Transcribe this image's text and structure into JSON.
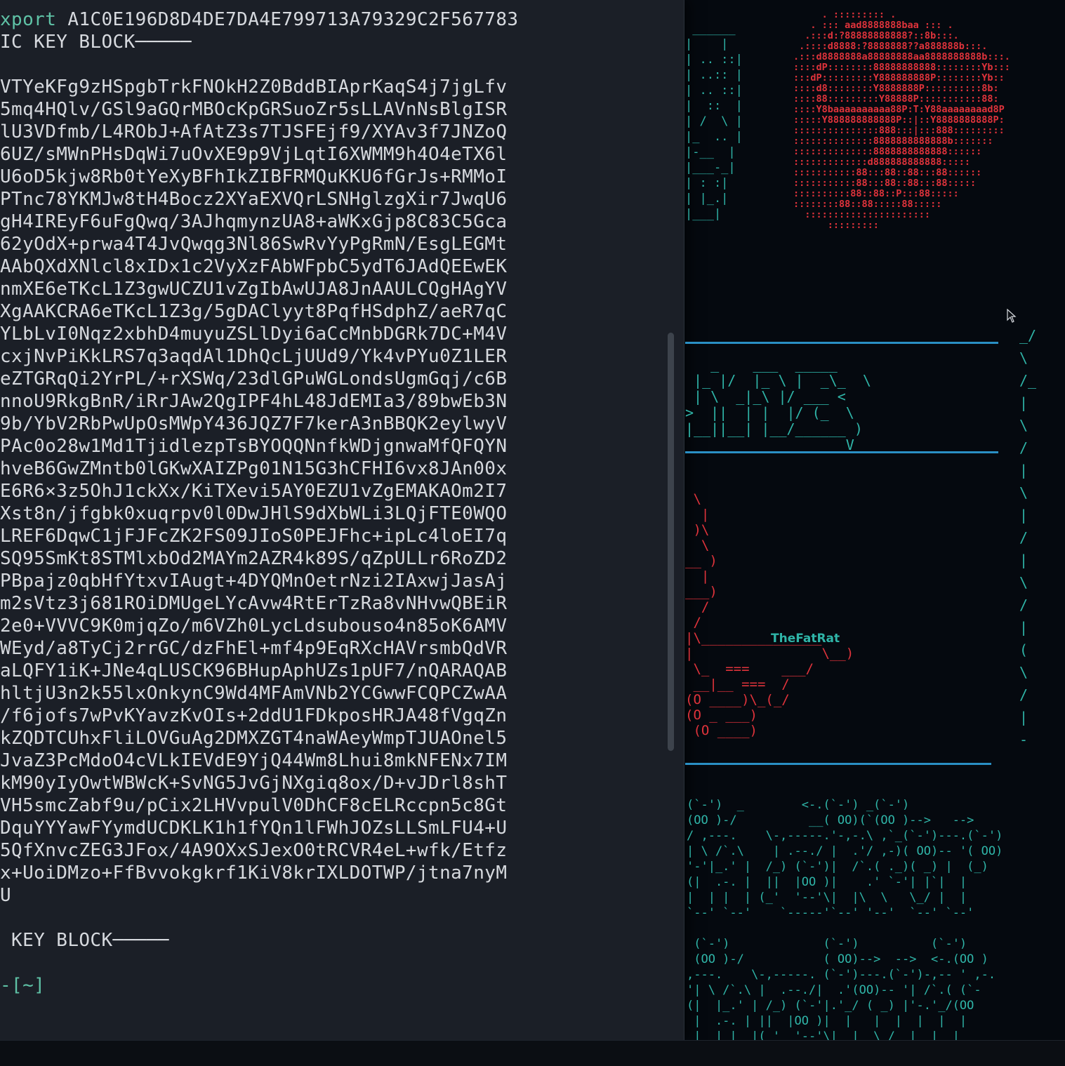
{
  "terminal": {
    "lines": [
      "xport A1C0E196D8D4DE7DA4E799713A79329C2F567783",
      "IC KEY BLOCK─────",
      "",
      "VTYeKFg9zHSpgbTrkFNOkH2Z0BddBIAprKaqS4j7jgLfv",
      "5mq4HQlv/GSl9aGQrMBOcKpGRSuoZr5sLLAVnNsBlgISR",
      "lU3VDfmb/L4RObJ+AfAtZ3s7TJSFEjf9/XYAv3f7JNZoQ",
      "6UZ/sMWnPHsDqWi7uOvXE9p9VjLqtI6XWMM9h4O4eTX6l",
      "U6oD5kjw8Rb0tYeXyBFhIkZIBFRMQuKKU6fGrJs+RMMoI",
      "PTnc78YKMJw8tH4Bocz2XYaEXVQrLSNHglzgXir7JwqU6",
      "gH4IREyF6uFgQwq/3AJhqmynzUA8+aWKxGjp8C83C5Gca",
      "62yOdX+prwa4T4JvQwqg3Nl86SwRvYyPgRmN/EsgLEGMt",
      "AAbQXdXNlcl8xIDx1c2VyXzFAbWFpbC5ydT6JAdQEEwEK",
      "nmXE6eTKcL1Z3gwUCZU1vZgIbAwUJA8JnAAULCQgHAgYV",
      "XgAAKCRA6eTKcL1Z3g/5gDAClyyt8PqfHSdphZ/aeR7qC",
      "YLbLvI0Nqz2xbhD4muyuZSLlDyi6aCcMnbDGRk7DC+M4V",
      "cxjNvPiKkLRS7q3aqdAl1DhQcLjUUd9/Yk4vPYu0Z1LER",
      "eZTGRqQi2YrPL/+rXSWq/23dlGPuWGLondsUgmGqj/c6B",
      "nnoU9RkgBnR/iRrJAw2QgIPF4hL48JdEMIa3/89bwEb3N",
      "9b/YbV2RbPwUpOsMWpY436JQZ7F7kerA3nBBQK2eylwyV",
      "PAc0o28w1Md1TjidlezpTsBYOQQNnfkWDjgnwaMfQFQYN",
      "hveB6GwZMntb0lGKwXAIZPg01N15G3hCFHI6vx8JAn00x",
      "E6R6×3z5OhJ1ckXx/KiTXevi5AY0EZU1vZgEMAKAOm2I7",
      "Xst8n/jfgbk0xuqrpv0l0DwJHlS9dXbWLi3LQjFTE0WQO",
      "LREF6DqwC1jFJFcZK2FS09JIoS0PEJFhc+ipLc4loEI7q",
      "SQ95SmKt8STMlxbOd2MAYm2AZR4k89S/qZpULLr6RoZD2",
      "PBpajz0qbHfYtxvIAugt+4DYQMnOetrNzi2IAxwjJasAj",
      "m2sVtz3j681ROiDMUgeLYcAvw4RtErTzRa8vNHvwQBEiR",
      "2e0+VVVC9K0mjqZo/m6VZh0LycLdsubouso4n85oK6AMV",
      "WEyd/a8TyCj2rrGC/dzFhEl+mf4p9EqRXcHAVrsmbQdVR",
      "aLQFY1iK+JNe4qLUSCK96BHupAphUZs1pUF7/nQARAQAB",
      "hltjU3n2k55lxOnkynC9Wd4MFAmVNb2YCGwwFCQPCZwAA",
      "/f6jofs7wPvKYavzKvOIs+2ddU1FDkposHRJA48fVgqZn",
      "kZQDTCUhxFliLOVGuAg2DMXZGT4naWAeyWmpTJUAOnel5",
      "JvaZ3PcMdoO4cVLkIEVdE9YjQ44Wm8Lhui8mkNFENx7IM",
      "kM90yIyOwtWBWcK+SvNG5JvGjNXgiq8ox/D+vJDrl8shT",
      "VH5smcZabf9u/pCix2LHVvpulV0DhCF8cELRccpn5c8Gt",
      "DquYYYawFYymdUCDKLK1h1fYQn1lFWhJOZsLLSmLFU4+U",
      "5QfXnvcZEG3JFox/4A9OXxSJexO0tRCVR4eL+wfk/Etfz",
      "x+UoiDMzo+FfBvvokgkrf1KiV8krIXLDOTWP/jtna7nyM",
      "U",
      "",
      " KEY BLOCK─────",
      "",
      "-[~]"
    ]
  },
  "art": {
    "label": "TheFatRat",
    "topleft": " ______\n|    |\n| .. ::|\n| ..:: |\n| .. ::|\n|  ::  |\n| /  \\ |\n|_  .. |\n|-__  |\n|___-_|\n| : :|\n| |_.|\n|___|",
    "moon": "     . ::::::::: .\n   . ::: aad8888888baa ::: .\n  .:::d:?88888888888?::8b:::.\n .::::d8888:?8888888??a888888b:::.\n.:::d8888888a88888888aa8888888888b:::.\n::::dP::::::::88888888888::::::::Yb:::\n:::dP:::::::::Y888888888P::::::::Yb::\n::::d8::::::::Y8888888P::::::::::8b:\n::::88:::::::::Y88888P:::::::::::88:\n::::Y8baaaaaaaaaa88P:T:Y88aaaaaaaad8P\n:::::Y888888888888P::|::Y8888888888P:\n:::::::::::::::888:::|:::888:::::::::\n::::::::::::::8888888888888b:::::::\n::::::::::::::8888888888888::::::\n:::::::::::::d888888888888:::::\n:::::::::::88:::88::88:::88::::::\n:::::::::::88:::88::88:::88:::::\n::::::::::88::88::P:::88:::::\n::::::::88::88:::::88:::::\n  ::::::::::::::::::::::\n      :::::::::",
    "fatrat": "   _    ___  _____\n |_ |/  |_ \\ |  _\\_  \\\n | \\  _|_\\ |/ ___ <\n>  ||  | |  |/ (_  \\\n|__||__| |__/______ )\n                   V",
    "gun": " \\\n  |\n )\\\n  \\\n__ )\n  |\n___)\n  /\n /        \n|\\_______________\n|                \\__)\n \\_  ===    ___/\n __|__ ===  /\n(O ____)\\_(_/\n(O _ ___)\n (O ____)",
    "ghosts": "(`-')  _        <-.(`-') _(`-')\n(OO )-/          __( OO)(`(OO )-->   -->\n/ ,---.    \\-,-----.'-,-.\\ ,`_(`-')---.(`-')\n| \\ /`.\\    | .--./ |  .'/ ,-)( OO)-- '( OO)\n'-'|_.' |  /_) (`-')|  /`.( ._)( _) |  (_)\n(|  .-. |  ||  |OO )|    .' `-'| |`|  |\n|  | |  | (_'  '--'\\|  |\\  \\   \\_/ |  |\n`--' `--'    `-----'`--' '--'  `--' `--'\n\n (`-')             (`-')          (`-')\n (OO )-/           ( OO)-->  -->  <-.(OO )\n,---.    \\-,-----. (`-')---.(`-')-,-- ' ,-.\n'| \\ /`.\\ |  .--./|  .'(OO)-- '| /`.( (`-\n(|  |_.' | /_) (`-'|.'_/ ( _) |'-.'_/(OO\n |  .-. | ||  |OO )|  |   |  |  |  |  |\n |  | |  |(_'  '--'\\|  |  \\_/  |  |  |\n `--' `--'  `-----'`--'  `--' `--' `--'",
    "side": "_/\n\\\n/_\n|\n\\\n/\n|\n\\\n|\n/\n|\n\\\n/\n|\n(\n\\\n/\n|\n-"
  },
  "colors": {
    "terminal_bg": "#1b1f27",
    "terminal_text": "#d6d9de",
    "prompt_green": "#5fc2a6",
    "art_teal": "#2fb5a8",
    "art_red": "#e0333b",
    "divider_blue": "#2a8fc4",
    "desktop_bg": "#05090f"
  }
}
